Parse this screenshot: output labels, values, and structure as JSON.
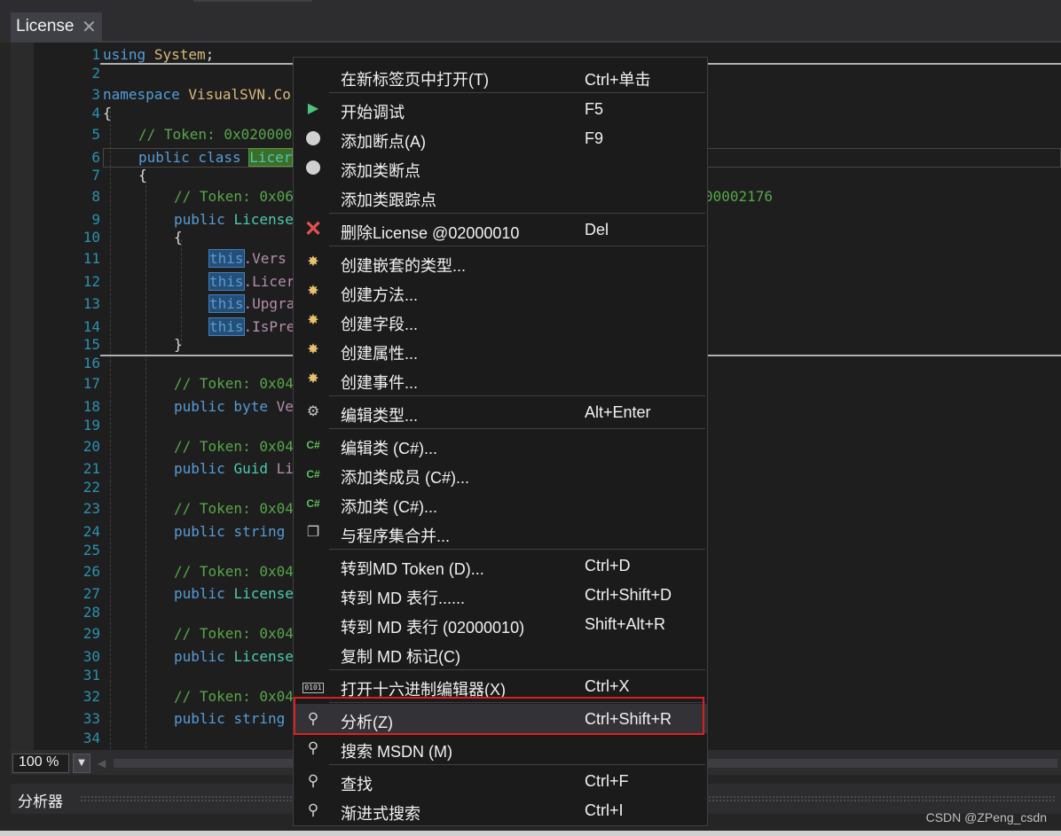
{
  "tab": {
    "title": "License",
    "close_glyph": "✕"
  },
  "editor": {
    "line_numbers": [
      "1",
      "2",
      "3",
      "4",
      "5",
      "6",
      "7",
      "8",
      "9",
      "10",
      "11",
      "12",
      "13",
      "14",
      "15",
      "16",
      "17",
      "18",
      "19",
      "20",
      "21",
      "22",
      "23",
      "24",
      "25",
      "26",
      "27",
      "28",
      "29",
      "30",
      "31",
      "32",
      "33",
      "34"
    ],
    "code": {
      "l1_kw": "using",
      "l1_ns": "System",
      "l1_end": ";",
      "l3_kw": "namespace",
      "l3_ns": "VisualSVN.Co",
      "l4": "{",
      "l5": "// Token: 0x020000",
      "l6_kw": "public class",
      "l6_cls": "Licer",
      "l7": "{",
      "l8": "// Token: 0x06",
      "l8_right": "00002176",
      "l9_kw": "public",
      "l9_rest": "License",
      "l10": "{",
      "l11_this": "this",
      "l11_rest": ".Vers",
      "l12_this": "this",
      "l12_rest": ".Licer",
      "l13_this": "this",
      "l13_rest": ".Upgra",
      "l14_this": "this",
      "l14_rest": ".IsPre",
      "l15": "}",
      "l17": "// Token: 0x04",
      "l18_kw": "public byte",
      "l18_rest": "Ve",
      "l20": "// Token: 0x04",
      "l21_kw": "public",
      "l21_ty": "Guid",
      "l21_rest": "Li",
      "l23": "// Token: 0x04",
      "l24_kw": "public string",
      "l26": "// Token: 0x04",
      "l27_kw": "public",
      "l27_rest": "License",
      "l29": "// Token: 0x04",
      "l30_kw": "public",
      "l30_rest": "License",
      "l32": "// Token: 0x04",
      "l33_kw": "public string"
    }
  },
  "status": {
    "zoom": "100 %",
    "dropdown_glyph": "▼",
    "scroll_left_glyph": "◀"
  },
  "analyzer": {
    "label": "分析器"
  },
  "watermark": "CSDN @ZPeng_csdn",
  "context_menu": {
    "open_new_tab": {
      "label": "在新标签页中打开(T)",
      "shortcut": "Ctrl+单击"
    },
    "start_debug": {
      "label": "开始调试",
      "shortcut": "F5",
      "icon": "play-icon"
    },
    "add_breakpoint": {
      "label": "添加断点(A)",
      "shortcut": "F9",
      "icon": "breakpoint-icon"
    },
    "add_class_breakpoint": {
      "label": "添加类断点",
      "icon": "breakpoint-icon"
    },
    "add_class_tracepoint": {
      "label": "添加类跟踪点"
    },
    "delete": {
      "label": "删除License @02000010",
      "shortcut": "Del",
      "icon": "delete-icon"
    },
    "create_nested_type": {
      "label": "创建嵌套的类型...",
      "icon": "wand-icon"
    },
    "create_method": {
      "label": "创建方法...",
      "icon": "wand-icon"
    },
    "create_field": {
      "label": "创建字段...",
      "icon": "wand-icon"
    },
    "create_property": {
      "label": "创建属性...",
      "icon": "wand-icon"
    },
    "create_event": {
      "label": "创建事件...",
      "icon": "wand-icon"
    },
    "edit_type": {
      "label": "编辑类型...",
      "shortcut": "Alt+Enter",
      "icon": "gear-icon"
    },
    "edit_class_cs": {
      "label": "编辑类 (C#)...",
      "icon": "csharp-icon"
    },
    "add_class_member_cs": {
      "label": "添加类成员 (C#)...",
      "icon": "csharp-icon"
    },
    "add_class_cs": {
      "label": "添加类 (C#)...",
      "icon": "csharp-icon"
    },
    "merge_assembly": {
      "label": "与程序集合并...",
      "icon": "merge-icon"
    },
    "goto_md_token": {
      "label": "转到MD Token (D)...",
      "shortcut": "Ctrl+D"
    },
    "goto_md_row": {
      "label": "转到 MD 表行......",
      "shortcut": "Ctrl+Shift+D"
    },
    "goto_md_row_id": {
      "label": "转到 MD 表行 (02000010)",
      "shortcut": "Shift+Alt+R"
    },
    "copy_md_token": {
      "label": "复制 MD 标记(C)"
    },
    "open_hex_editor": {
      "label": "打开十六进制编辑器(X)",
      "shortcut": "Ctrl+X",
      "icon": "hex-icon"
    },
    "analyze": {
      "label": "分析(Z)",
      "shortcut": "Ctrl+Shift+R",
      "icon": "search-icon"
    },
    "search_msdn": {
      "label": "搜索 MSDN (M)",
      "icon": "search-icon"
    },
    "find": {
      "label": "查找",
      "shortcut": "Ctrl+F",
      "icon": "search-icon"
    },
    "incremental_search": {
      "label": "渐进式搜索",
      "shortcut": "Ctrl+I",
      "icon": "search-icon"
    }
  },
  "colors": {
    "editor_bg": "#1e1e1e",
    "menu_bg": "#1b1b1c",
    "keyword": "#569cd6",
    "type": "#4ec9b0",
    "comment": "#57a64a",
    "line_number": "#2b91af",
    "highlight_box": "#d92020"
  }
}
